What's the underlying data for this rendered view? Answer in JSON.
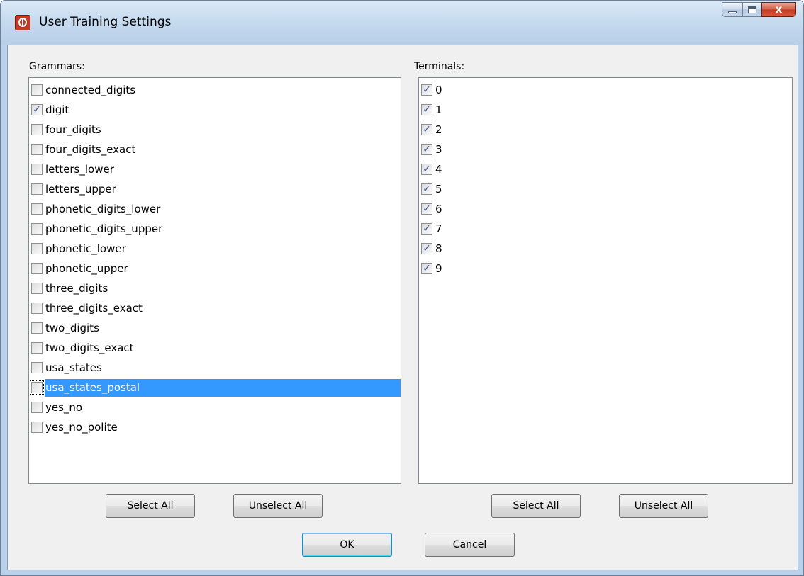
{
  "window": {
    "title": "User Training Settings",
    "close_glyph": "x"
  },
  "grammars": {
    "label": "Grammars:",
    "items": [
      {
        "label": "connected_digits",
        "checked": false
      },
      {
        "label": "digit",
        "checked": true
      },
      {
        "label": "four_digits",
        "checked": false
      },
      {
        "label": "four_digits_exact",
        "checked": false
      },
      {
        "label": "letters_lower",
        "checked": false
      },
      {
        "label": "letters_upper",
        "checked": false
      },
      {
        "label": "phonetic_digits_lower",
        "checked": false
      },
      {
        "label": "phonetic_digits_upper",
        "checked": false
      },
      {
        "label": "phonetic_lower",
        "checked": false
      },
      {
        "label": "phonetic_upper",
        "checked": false
      },
      {
        "label": "three_digits",
        "checked": false
      },
      {
        "label": "three_digits_exact",
        "checked": false
      },
      {
        "label": "two_digits",
        "checked": false
      },
      {
        "label": "two_digits_exact",
        "checked": false
      },
      {
        "label": "usa_states",
        "checked": false
      },
      {
        "label": "usa_states_postal",
        "checked": false,
        "selected": true
      },
      {
        "label": "yes_no",
        "checked": false
      },
      {
        "label": "yes_no_polite",
        "checked": false
      }
    ],
    "select_all_label": "Select All",
    "unselect_all_label": "Unselect All"
  },
  "terminals": {
    "label": "Terminals:",
    "items": [
      {
        "label": "0",
        "checked": true
      },
      {
        "label": "1",
        "checked": true
      },
      {
        "label": "2",
        "checked": true
      },
      {
        "label": "3",
        "checked": true
      },
      {
        "label": "4",
        "checked": true
      },
      {
        "label": "5",
        "checked": true
      },
      {
        "label": "6",
        "checked": true
      },
      {
        "label": "7",
        "checked": true
      },
      {
        "label": "8",
        "checked": true
      },
      {
        "label": "9",
        "checked": true
      }
    ],
    "select_all_label": "Select All",
    "unselect_all_label": "Unselect All"
  },
  "footer": {
    "ok_label": "OK",
    "cancel_label": "Cancel"
  },
  "colors": {
    "selection": "#3399ff",
    "checkmark": "#3a4f9a",
    "dialog_bg": "#f0f0f0"
  }
}
